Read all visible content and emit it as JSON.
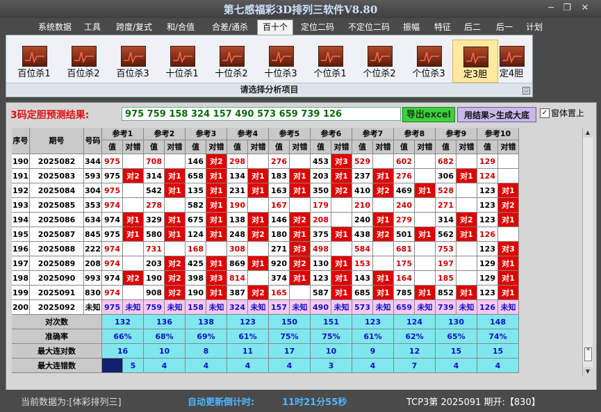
{
  "title": "第七感福彩3D排列三软件V8.80",
  "window_buttons": [
    "─",
    "❐",
    "✕"
  ],
  "menu": [
    "系统数据",
    "工具",
    "跨度/复式",
    "和/合值",
    "合差/通杀",
    "百十个",
    "定位二码",
    "不定位二码",
    "振幅",
    "特征",
    "后二",
    "后一",
    "计划"
  ],
  "menu_active": 5,
  "ribbon": {
    "buttons": [
      "百位杀1",
      "百位杀2",
      "百位杀3",
      "十位杀1",
      "十位杀2",
      "十位杀3",
      "个位杀1",
      "个位杀2",
      "个位杀3",
      "定3胆",
      "定4胆"
    ],
    "selected": 9,
    "caption": "请选择分析项目",
    "launcher": "◲"
  },
  "prediction": {
    "label": "3码定胆预测结果:",
    "value": "975 759 158 324 157 490 573 659 739 126",
    "excel_button": "导出excel",
    "generate_button": "用结果>生成大底",
    "checkbox_mark": "✓",
    "checkbox_label": "窗体置上"
  },
  "table": {
    "headers": {
      "seq": "序号",
      "issue": "期号",
      "code": "号码",
      "sub_val": "值",
      "sub_hit": "对错"
    },
    "refs": [
      "参考1",
      "参考2",
      "参考3",
      "参考4",
      "参考5",
      "参考6",
      "参考7",
      "参考8",
      "参考9",
      "参考10"
    ],
    "rows": [
      {
        "seq": "190",
        "issue": "2025082",
        "code": "344",
        "cells": [
          [
            "975",
            "",
            0
          ],
          [
            "708",
            "",
            0
          ],
          [
            "146",
            "对2",
            1
          ],
          [
            "298",
            "",
            0
          ],
          [
            "276",
            "",
            0
          ],
          [
            "453",
            "对3",
            1
          ],
          [
            "529",
            "",
            0
          ],
          [
            "602",
            "",
            0
          ],
          [
            "682",
            "",
            0
          ],
          [
            "129",
            "",
            0
          ]
        ]
      },
      {
        "seq": "191",
        "issue": "2025083",
        "code": "593",
        "cells": [
          [
            "975",
            "对2",
            1
          ],
          [
            "314",
            "对1",
            1
          ],
          [
            "658",
            "对1",
            1
          ],
          [
            "134",
            "对1",
            1
          ],
          [
            "183",
            "对1",
            1
          ],
          [
            "203",
            "对1",
            1
          ],
          [
            "237",
            "对1",
            1
          ],
          [
            "276",
            "",
            0
          ],
          [
            "306",
            "对1",
            1
          ],
          [
            "124",
            "",
            0
          ]
        ]
      },
      {
        "seq": "192",
        "issue": "2025084",
        "code": "304",
        "cells": [
          [
            "975",
            "",
            0
          ],
          [
            "542",
            "对1",
            1
          ],
          [
            "135",
            "对1",
            1
          ],
          [
            "231",
            "对1",
            1
          ],
          [
            "163",
            "对1",
            1
          ],
          [
            "350",
            "对2",
            1
          ],
          [
            "410",
            "对2",
            1
          ],
          [
            "469",
            "对1",
            1
          ],
          [
            "528",
            "",
            0
          ],
          [
            "123",
            "对1",
            1
          ]
        ]
      },
      {
        "seq": "193",
        "issue": "2025085",
        "code": "353",
        "cells": [
          [
            "974",
            "",
            0
          ],
          [
            "278",
            "",
            0
          ],
          [
            "582",
            "对1",
            1
          ],
          [
            "190",
            "",
            0
          ],
          [
            "167",
            "",
            0
          ],
          [
            "179",
            "",
            0
          ],
          [
            "210",
            "",
            0
          ],
          [
            "240",
            "",
            0
          ],
          [
            "271",
            "",
            0
          ],
          [
            "123",
            "对2",
            1
          ]
        ]
      },
      {
        "seq": "194",
        "issue": "2025086",
        "code": "634",
        "cells": [
          [
            "974",
            "对1",
            1
          ],
          [
            "329",
            "对1",
            1
          ],
          [
            "675",
            "对1",
            1
          ],
          [
            "138",
            "对1",
            1
          ],
          [
            "146",
            "对2",
            1
          ],
          [
            "208",
            "",
            0
          ],
          [
            "240",
            "对1",
            1
          ],
          [
            "279",
            "",
            0
          ],
          [
            "314",
            "对2",
            1
          ],
          [
            "123",
            "对1",
            1
          ]
        ]
      },
      {
        "seq": "195",
        "issue": "2025087",
        "code": "845",
        "cells": [
          [
            "975",
            "对1",
            1
          ],
          [
            "580",
            "对1",
            1
          ],
          [
            "124",
            "对1",
            1
          ],
          [
            "248",
            "对2",
            1
          ],
          [
            "180",
            "对1",
            1
          ],
          [
            "375",
            "对1",
            1
          ],
          [
            "438",
            "对2",
            1
          ],
          [
            "501",
            "对1",
            1
          ],
          [
            "562",
            "对1",
            1
          ],
          [
            "126",
            "",
            0
          ]
        ]
      },
      {
        "seq": "196",
        "issue": "2025088",
        "code": "222",
        "cells": [
          [
            "974",
            "",
            0
          ],
          [
            "731",
            "",
            0
          ],
          [
            "168",
            "",
            0
          ],
          [
            "308",
            "",
            0
          ],
          [
            "271",
            "对3",
            1
          ],
          [
            "498",
            "",
            0
          ],
          [
            "584",
            "",
            0
          ],
          [
            "681",
            "",
            0
          ],
          [
            "753",
            "",
            0
          ],
          [
            "123",
            "对3",
            1
          ]
        ]
      },
      {
        "seq": "197",
        "issue": "2025089",
        "code": "208",
        "cells": [
          [
            "974",
            "",
            0
          ],
          [
            "203",
            "对2",
            1
          ],
          [
            "425",
            "对1",
            1
          ],
          [
            "869",
            "对1",
            1
          ],
          [
            "920",
            "对2",
            1
          ],
          [
            "130",
            "对1",
            1
          ],
          [
            "153",
            "",
            0
          ],
          [
            "175",
            "",
            0
          ],
          [
            "197",
            "",
            0
          ],
          [
            "129",
            "对1",
            1
          ]
        ]
      },
      {
        "seq": "198",
        "issue": "2025090",
        "code": "993",
        "cells": [
          [
            "974",
            "对2",
            1
          ],
          [
            "190",
            "对2",
            1
          ],
          [
            "398",
            "对3",
            1
          ],
          [
            "814",
            "",
            0
          ],
          [
            "374",
            "对1",
            1
          ],
          [
            "123",
            "对1",
            1
          ],
          [
            "143",
            "对1",
            1
          ],
          [
            "164",
            "",
            0
          ],
          [
            "185",
            "",
            0
          ],
          [
            "129",
            "对1",
            1
          ]
        ]
      },
      {
        "seq": "199",
        "issue": "2025091",
        "code": "830",
        "cells": [
          [
            "974",
            "",
            0
          ],
          [
            "908",
            "对2",
            1
          ],
          [
            "190",
            "对1",
            1
          ],
          [
            "387",
            "对2",
            1
          ],
          [
            "165",
            "",
            0
          ],
          [
            "587",
            "对1",
            1
          ],
          [
            "685",
            "对1",
            1
          ],
          [
            "785",
            "对1",
            1
          ],
          [
            "852",
            "对1",
            1
          ],
          [
            "123",
            "对1",
            1
          ]
        ]
      }
    ],
    "predict_row": {
      "seq": "200",
      "issue": "2025092",
      "code": "未知",
      "vals": [
        "975",
        "759",
        "158",
        "324",
        "157",
        "490",
        "573",
        "659",
        "739",
        "126"
      ],
      "hit": "未知"
    },
    "stats": [
      {
        "label": "对次数",
        "values": [
          "132",
          "136",
          "138",
          "123",
          "150",
          "151",
          "123",
          "124",
          "130",
          "148"
        ]
      },
      {
        "label": "准确率",
        "values": [
          "66%",
          "68%",
          "69%",
          "61%",
          "75%",
          "75%",
          "61%",
          "62%",
          "65%",
          "74%"
        ]
      },
      {
        "label": "最大连对数",
        "values": [
          "16",
          "10",
          "8",
          "11",
          "17",
          "10",
          "9",
          "12",
          "15",
          "15"
        ]
      },
      {
        "label": "最大连错数",
        "values": [
          "5",
          "4",
          "4",
          "4",
          "4",
          "3",
          "4",
          "7",
          "4",
          "4"
        ]
      }
    ]
  },
  "scrollbar": {
    "up": "▲",
    "down": "▼",
    "grip": "≡"
  },
  "status": {
    "source": "当前数据为:[体彩排列三]",
    "countdown_label": "自动更新倒计时:",
    "countdown_value": "11时21分55秒",
    "draw_info": "TCP3第 2025091 期开:【830】"
  },
  "colors": {
    "hit_bg": "#e00000",
    "value_red": "#cc0000",
    "predict_bg": "#f7c9f1",
    "stat_bg": "#7fe7ee",
    "stat_text": "#1010c8",
    "header_bg": "#c9c9c9",
    "selected_cell": "#10206a"
  }
}
